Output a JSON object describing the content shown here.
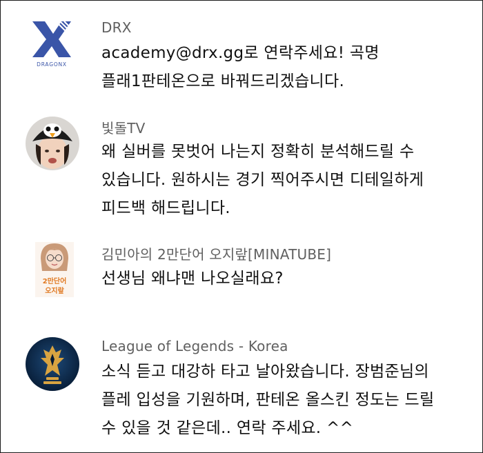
{
  "comments": [
    {
      "author": "DRX",
      "avatar_icon": "drx-dragonx-logo-icon",
      "avatar_caption": "DRAGONX",
      "lines": [
        "academy@drx.gg로 연락주세요! 곡명",
        "플래1판테온으로 바꿔드리겠습니다."
      ]
    },
    {
      "author": "빛돌TV",
      "avatar_icon": "penguin-hat-user-avatar-icon",
      "lines": [
        "왜 실버를 못벗어 나는지 정확히 분석해드릴 수",
        "있습니다. 원하시는 경기 찍어주시면 디테일하게",
        "피드백 해드립니다."
      ]
    },
    {
      "author": "김민아의 2만단어 오지랖[MINATUBE]",
      "avatar_icon": "minatube-user-avatar-icon",
      "avatar_caption": [
        "2만단어",
        "오지랖"
      ],
      "lines": [
        "선생님 왜냐맨 나오실래요?"
      ]
    },
    {
      "author": "League of Legends - Korea",
      "avatar_icon": "lol-crest-logo-icon",
      "lines": [
        "소식 듣고 대강하 타고 날아왔습니다. 장범준님의",
        "플레 입성을 기원하며, 판테온 올스킨 정도는 드릴",
        "수 있을 것 같은데.. 연락 주세요. ^^"
      ]
    }
  ],
  "colors": {
    "author_text": "#606060",
    "comment_text": "#111111",
    "drx_blue": "#3a55a8",
    "lol_navy": "#0c2a4a",
    "lol_gold": "#d9a441"
  }
}
